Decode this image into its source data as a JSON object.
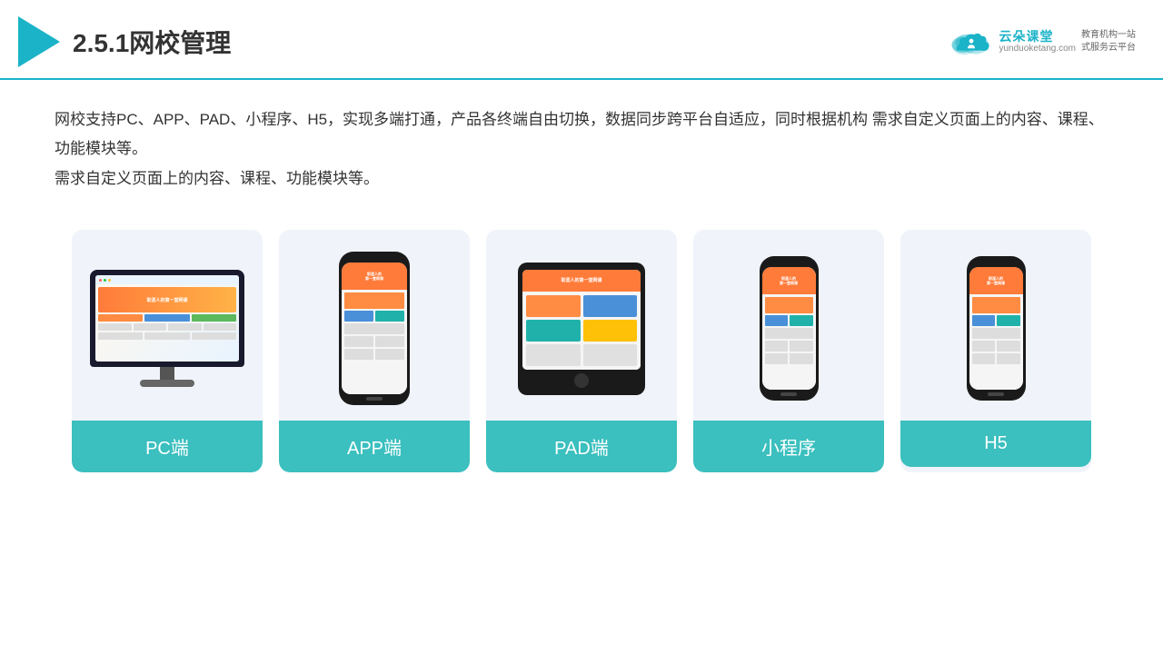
{
  "header": {
    "title": "2.5.1网校管理",
    "brand": {
      "name": "云朵课堂",
      "url": "yunduoketang.com",
      "slogan": "教育机构一站\n式服务云平台"
    }
  },
  "description": "网校支持PC、APP、PAD、小程序、H5，实现多端打通，产品各终端自由切换，数据同步跨平台自适应，同时根据机构\n需求自定义页面上的内容、课程、功能模块等。",
  "cards": [
    {
      "id": "pc",
      "label": "PC端",
      "device": "pc"
    },
    {
      "id": "app",
      "label": "APP端",
      "device": "phone"
    },
    {
      "id": "pad",
      "label": "PAD端",
      "device": "tablet"
    },
    {
      "id": "miniapp",
      "label": "小程序",
      "device": "phone"
    },
    {
      "id": "h5",
      "label": "H5",
      "device": "phone"
    }
  ],
  "colors": {
    "teal": "#3bbfbf",
    "header_line": "#1ab3c8",
    "card_bg": "#f0f4fa"
  }
}
